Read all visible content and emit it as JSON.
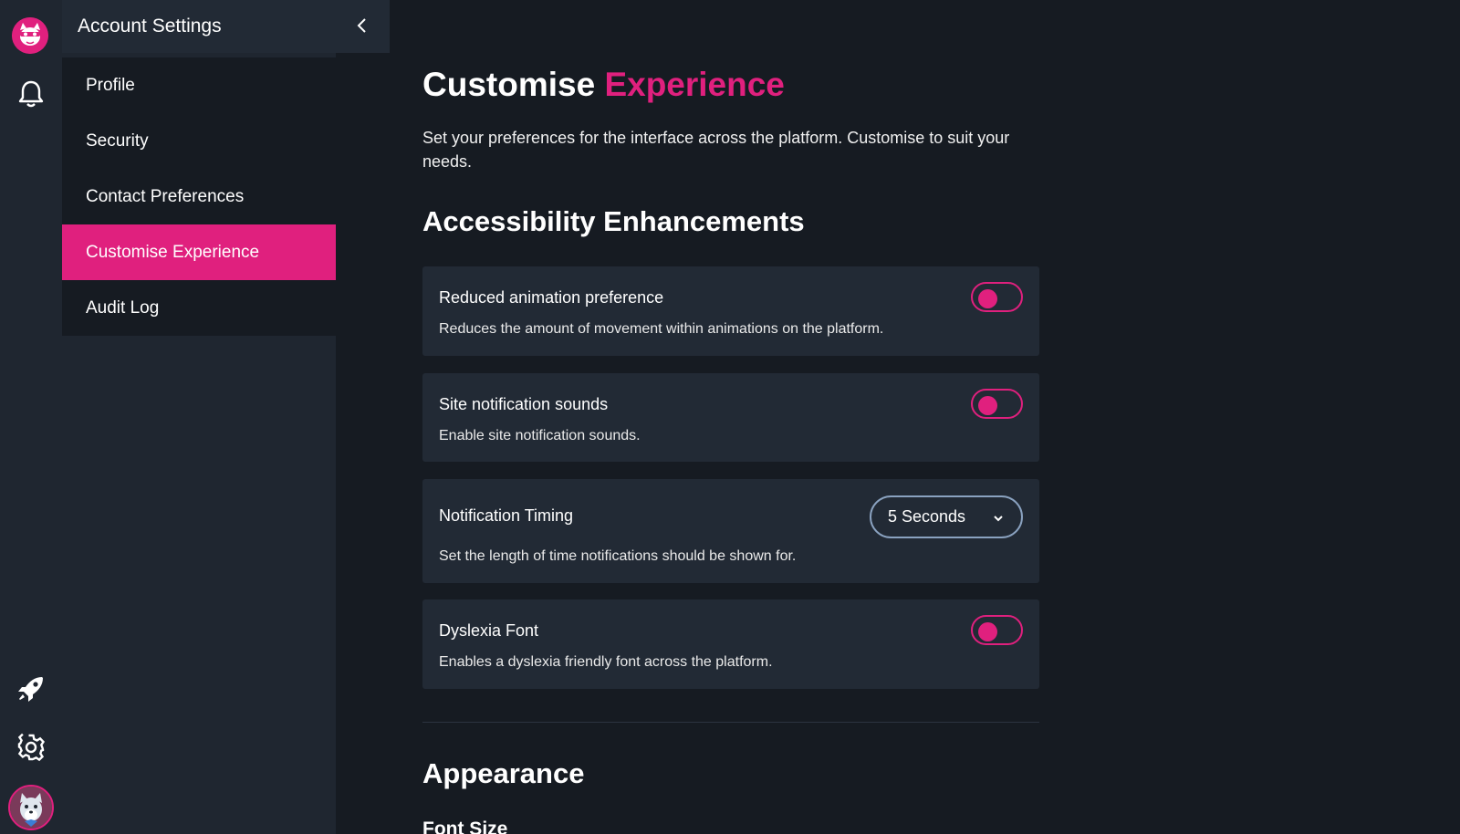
{
  "sidebar": {
    "title": "Account Settings",
    "items": [
      {
        "label": "Profile"
      },
      {
        "label": "Security"
      },
      {
        "label": "Contact Preferences"
      },
      {
        "label": "Customise Experience",
        "active": true
      },
      {
        "label": "Audit Log"
      }
    ]
  },
  "rail": {
    "icons": [
      "logo",
      "bell-icon",
      "rocket-icon",
      "gear-icon",
      "avatar"
    ]
  },
  "page": {
    "title_part1": "Customise",
    "title_part2": "Experience",
    "intro": "Set your preferences for the interface across the platform. Customise to suit your needs.",
    "sections": {
      "accessibility": "Accessibility Enhancements",
      "appearance": "Appearance",
      "font_size": "Font Size"
    },
    "cards": {
      "reduced_animation": {
        "title": "Reduced animation preference",
        "desc": "Reduces the amount of movement within animations on the platform.",
        "enabled": false
      },
      "notification_sounds": {
        "title": "Site notification sounds",
        "desc": "Enable site notification sounds.",
        "enabled": false
      },
      "notification_timing": {
        "title": "Notification Timing",
        "desc": "Set the length of time notifications should be shown for.",
        "value": "5 Seconds"
      },
      "dyslexia_font": {
        "title": "Dyslexia Font",
        "desc": "Enables a dyslexia friendly font across the platform.",
        "enabled": false
      }
    }
  },
  "colors": {
    "accent": "#e0207e",
    "background": "#161b22",
    "panel": "#1f2630",
    "card": "#222a35"
  }
}
